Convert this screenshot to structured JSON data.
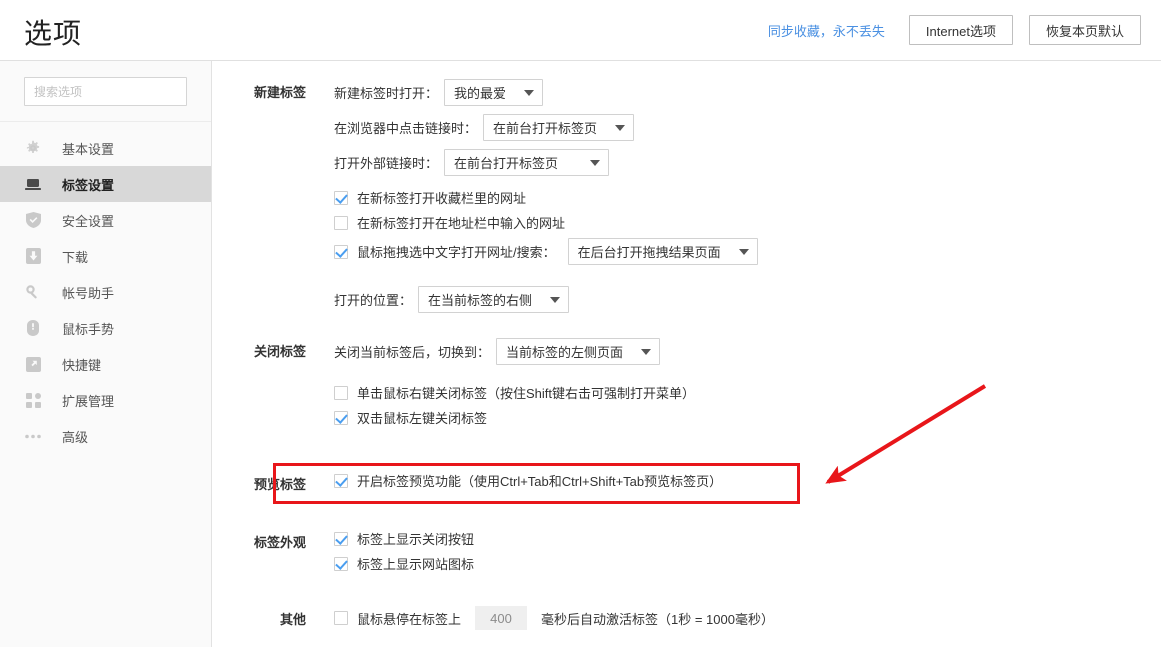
{
  "header": {
    "title": "选项",
    "sync_link": "同步收藏，永不丢失",
    "internet_options_button": "Internet选项",
    "restore_defaults_button": "恢复本页默认"
  },
  "sidebar": {
    "search": {
      "placeholder": "搜索选项",
      "value": ""
    },
    "items": [
      {
        "label": "基本设置",
        "icon": "gear-icon",
        "active": false
      },
      {
        "label": "标签设置",
        "icon": "laptop-icon",
        "active": true
      },
      {
        "label": "安全设置",
        "icon": "shield-check-icon",
        "active": false
      },
      {
        "label": "下载",
        "icon": "download-icon",
        "active": false
      },
      {
        "label": "帐号助手",
        "icon": "key-icon",
        "active": false
      },
      {
        "label": "鼠标手势",
        "icon": "mouse-icon",
        "active": false
      },
      {
        "label": "快捷键",
        "icon": "arrow-expand-icon",
        "active": false
      },
      {
        "label": "扩展管理",
        "icon": "grid-icon",
        "active": false
      },
      {
        "label": "高级",
        "icon": "ellipsis-icon",
        "active": false
      }
    ]
  },
  "main": {
    "new_tab": {
      "section_label": "新建标签",
      "open_on_new_tab_label": "新建标签时打开：",
      "open_on_new_tab_value": "我的最爱",
      "click_link_label": "在浏览器中点击链接时：",
      "click_link_value": "在前台打开标签页",
      "external_link_label": "打开外部链接时：",
      "external_link_value": "在前台打开标签页",
      "cb_bookmark_bar": "在新标签打开收藏栏里的网址",
      "cb_address_bar": "在新标签打开在地址栏中输入的网址",
      "cb_drag_text": "鼠标拖拽选中文字打开网址/搜索：",
      "drag_text_value": "在后台打开拖拽结果页面",
      "open_position_label": "打开的位置：",
      "open_position_value": "在当前标签的右侧"
    },
    "close_tab": {
      "section_label": "关闭标签",
      "switch_to_label": "关闭当前标签后，切换到：",
      "switch_to_value": "当前标签的左侧页面",
      "cb_right_click_close": "单击鼠标右键关闭标签（按住Shift键右击可强制打开菜单）",
      "cb_double_click_close": "双击鼠标左键关闭标签"
    },
    "preview_tab": {
      "section_label": "预览标签",
      "cb_enable_preview": "开启标签预览功能（使用Ctrl+Tab和Ctrl+Shift+Tab预览标签页）"
    },
    "tab_appearance": {
      "section_label": "标签外观",
      "cb_show_close_button": "标签上显示关闭按钮",
      "cb_show_favicon": "标签上显示网站图标"
    },
    "other": {
      "section_label": "其他",
      "cb_hover_activate": "鼠标悬停在标签上",
      "delay_value": "400",
      "suffix_text": "毫秒后自动激活标签（1秒 = 1000毫秒）"
    }
  },
  "annotation": {
    "highlight_color": "#e8161a",
    "arrow_color": "#e8161a"
  },
  "checkbox_states": {
    "bookmark_bar": true,
    "address_bar": false,
    "drag_text": true,
    "right_click_close": false,
    "double_click_close": true,
    "enable_preview": true,
    "show_close_button": true,
    "show_favicon": true,
    "hover_activate": false
  }
}
